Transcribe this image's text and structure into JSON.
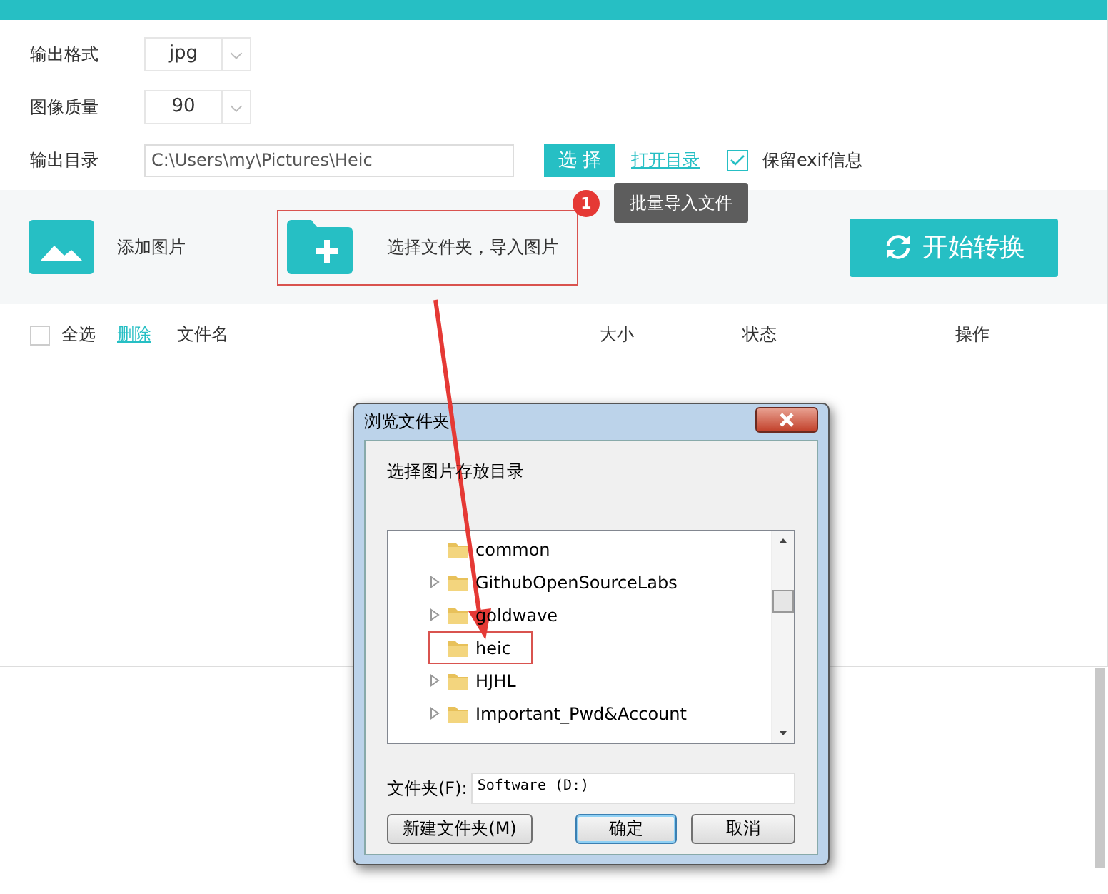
{
  "settings": [
    {
      "label": "输出格式",
      "kind": "select",
      "value": "jpg"
    },
    {
      "label": "图像质量",
      "kind": "select",
      "value": "90"
    },
    {
      "label": "输出目录",
      "kind": "path",
      "value": "C:\\Users\\my\\Pictures\\Heic"
    }
  ],
  "choose_button": "选 择",
  "open_dir_link": "打开目录",
  "keep_exif": {
    "label": "保留exif信息",
    "checked": true
  },
  "toolbar": {
    "add_image": "添加图片",
    "add_folder": {
      "label": "选择文件夹，导入图片",
      "marked": true
    },
    "start_button": "开始转换"
  },
  "tooltip": {
    "badge": "1",
    "text": "批量导入文件"
  },
  "table_header": {
    "select_all": {
      "label": "全选",
      "checked": false
    },
    "delete_link": "删除",
    "columns": [
      "文件名",
      "大小",
      "状态",
      "操作"
    ]
  },
  "dialog": {
    "title": "浏览文件夹",
    "prompt": "选择图片存放目录",
    "tree": [
      {
        "label": "common",
        "expandable": false,
        "marked": false
      },
      {
        "label": "GithubOpenSourceLabs",
        "expandable": true,
        "marked": false
      },
      {
        "label": "goldwave",
        "expandable": true,
        "marked": false
      },
      {
        "label": "heic",
        "expandable": false,
        "marked": true
      },
      {
        "label": "HJHL",
        "expandable": true,
        "marked": false
      },
      {
        "label": "Important_Pwd&Account",
        "expandable": true,
        "marked": false
      }
    ],
    "folder_label": "文件夹(F):",
    "folder_value": "Software (D:)",
    "buttons": [
      {
        "label": "新建文件夹(M)",
        "default": false
      },
      {
        "label": "确定",
        "default": true
      },
      {
        "label": "取消",
        "default": false
      }
    ]
  }
}
